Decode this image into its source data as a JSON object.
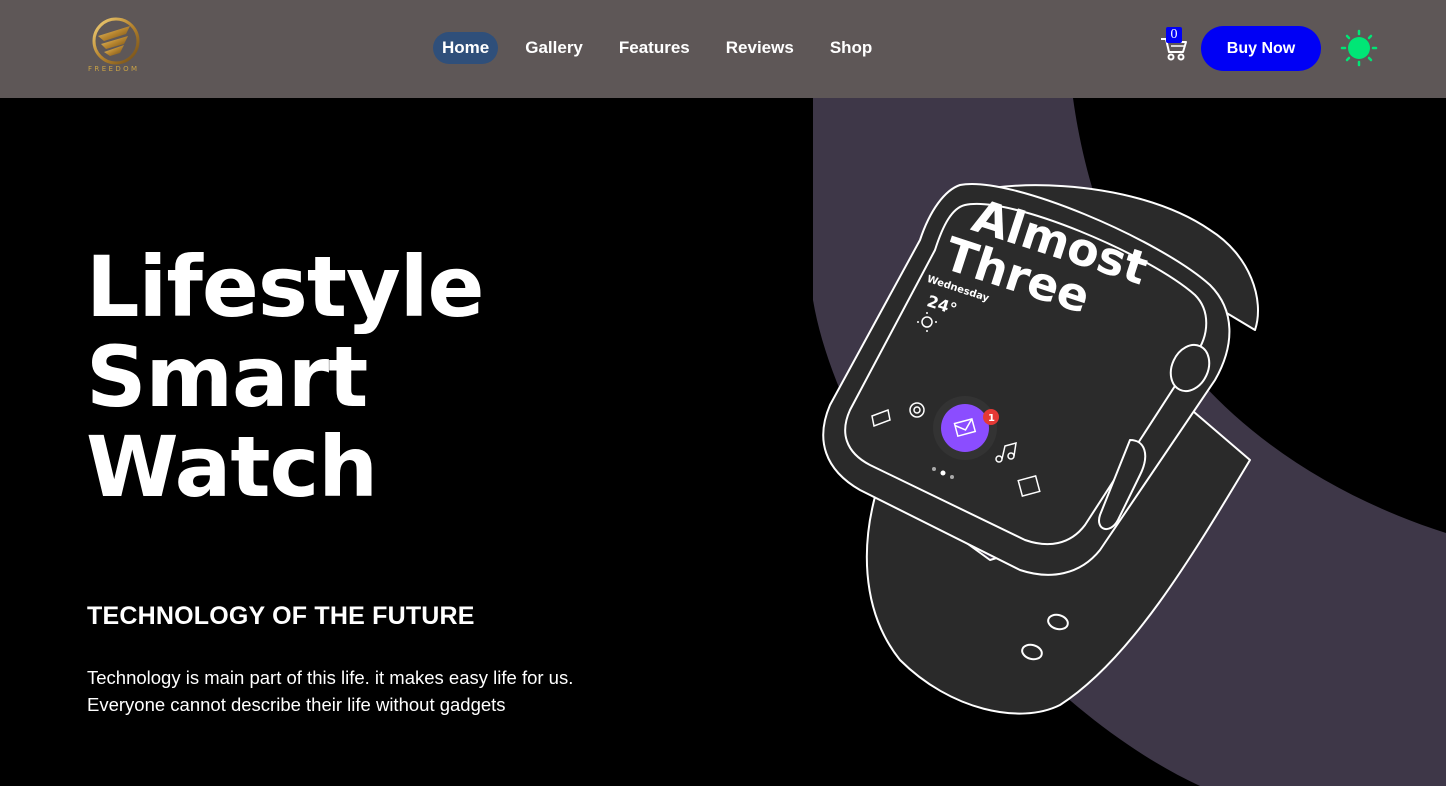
{
  "brand": {
    "logo_text": "FREEDOM"
  },
  "nav": {
    "items": [
      {
        "label": "Home",
        "active": true
      },
      {
        "label": "Gallery",
        "active": false
      },
      {
        "label": "Features",
        "active": false
      },
      {
        "label": "Reviews",
        "active": false
      },
      {
        "label": "Shop",
        "active": false
      }
    ]
  },
  "cart": {
    "count": "0",
    "icon": "cart-icon"
  },
  "actions": {
    "buy_label": "Buy Now",
    "theme_icon": "sun-icon"
  },
  "hero": {
    "title_lines": [
      "Lifestyle",
      "Smart",
      "Watch"
    ],
    "subheading": "TECHNOLOGY OF THE FUTURE",
    "description_lines": [
      "Technology is main part of this life. it makes easy life for us.",
      "Everyone cannot describe their life without gadgets"
    ]
  },
  "watch_screen": {
    "time_line1": "Almost",
    "time_line2": "Three",
    "day": "Wednesday",
    "temperature": "24°",
    "notification_count": "1"
  },
  "colors": {
    "navbar": "#5e5757",
    "active_nav": "#2f4f7a",
    "buy_button": "#0000f5",
    "theme_icon": "#00e676",
    "band_ring": "#3e3748",
    "watch_body": "#2a2a2a",
    "mail_bubble": "#8b4dff"
  }
}
